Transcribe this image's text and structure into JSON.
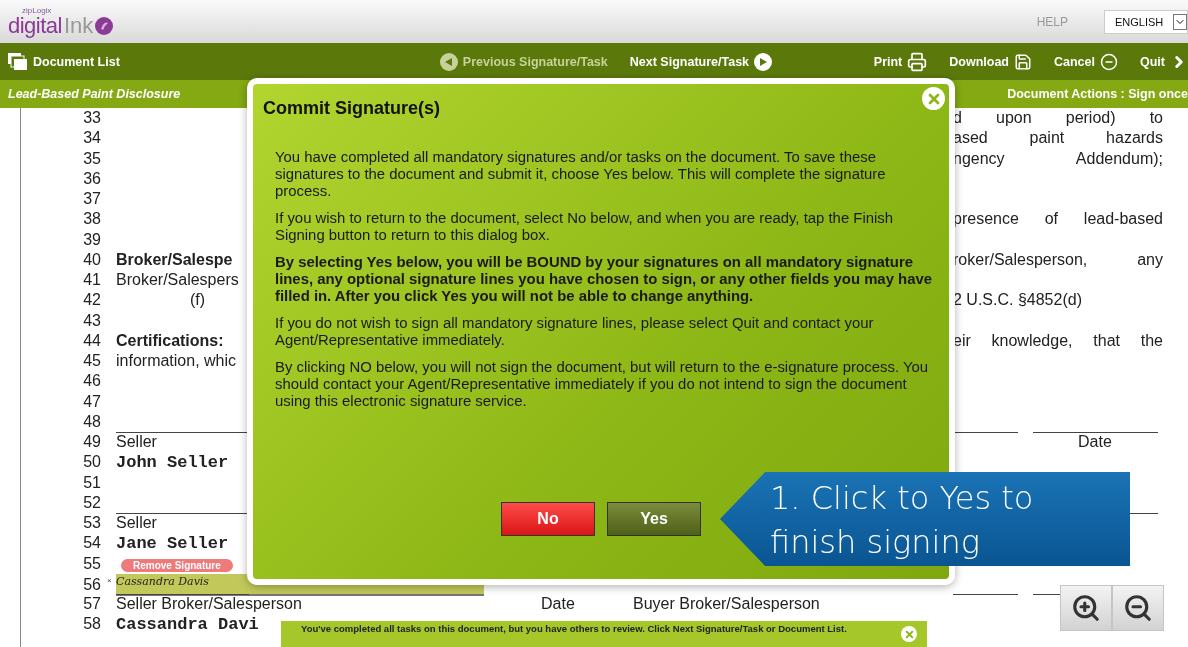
{
  "header": {
    "logo": {
      "tagline": "zipLogix",
      "name_primary": "digital",
      "name_secondary": "Ink"
    },
    "help": "HELP",
    "language": "ENGLISH"
  },
  "toolbar": {
    "left": [
      {
        "kind": "list",
        "label": "Document List",
        "disabled": false
      }
    ],
    "center": [
      {
        "kind": "prev",
        "label": "Previous Signature/Task",
        "disabled": true
      },
      {
        "kind": "next",
        "label": "Next Signature/Task",
        "disabled": false
      }
    ],
    "right": [
      {
        "kind": "print",
        "label": "Print",
        "disabled": false
      },
      {
        "kind": "download",
        "label": "Download",
        "disabled": false
      },
      {
        "kind": "cancel",
        "label": "Cancel",
        "disabled": false
      },
      {
        "kind": "quit",
        "label": "Quit",
        "disabled": false
      }
    ]
  },
  "subbar": {
    "document_title": "Lead-Based Paint Disclosure",
    "actions": "Document Actions : Sign once"
  },
  "document": {
    "lines": [
      {
        "number": "33",
        "right": {
          "kind": "text",
          "text": "d upon period) to"
        }
      },
      {
        "number": "34",
        "right": {
          "kind": "text",
          "text": "ased paint hazards"
        }
      },
      {
        "number": "35",
        "right": {
          "kind": "text",
          "text": "ngency Addendum);"
        }
      },
      {
        "number": "36"
      },
      {
        "number": "37"
      },
      {
        "number": "38",
        "right": {
          "kind": "text",
          "text": "presence of lead-based"
        }
      },
      {
        "number": "39"
      },
      {
        "number": "40",
        "left": [
          {
            "kind": "bold",
            "text": "Broker/Salespe"
          }
        ],
        "right": {
          "kind": "text",
          "text": "roker/Salesperson, any"
        }
      },
      {
        "number": "41",
        "left": [
          {
            "kind": "plain",
            "text": "Broker/Salespers"
          }
        ]
      },
      {
        "number": "42",
        "left": [
          {
            "kind": "indent",
            "text": "(f)"
          }
        ],
        "right": {
          "kind": "short",
          "text": "2 U.S.C. §4852(d)"
        }
      },
      {
        "number": "43"
      },
      {
        "number": "44",
        "left": [
          {
            "kind": "bold",
            "text": "Certifications:"
          }
        ],
        "right": {
          "kind": "text",
          "text": "eir knowledge, that the"
        }
      },
      {
        "number": "45",
        "left": [
          {
            "kind": "plain",
            "text": "information, whic"
          }
        ]
      },
      {
        "number": "46"
      },
      {
        "number": "47"
      },
      {
        "number": "48"
      },
      {
        "number": "49",
        "ruled": true,
        "left": [
          {
            "kind": "plain",
            "text": "Seller"
          }
        ],
        "right": {
          "kind": "caption",
          "text": "Date"
        }
      },
      {
        "number": "50",
        "left": [
          {
            "kind": "name",
            "text": "John Seller"
          }
        ]
      },
      {
        "number": "51"
      },
      {
        "number": "52"
      },
      {
        "number": "53",
        "ruled": true,
        "left": [
          {
            "kind": "plain",
            "text": "Seller"
          }
        ]
      },
      {
        "number": "54",
        "left": [
          {
            "kind": "name",
            "text": "Jane Seller"
          }
        ]
      },
      {
        "number": "55",
        "left": [
          {
            "kind": "remove",
            "text": "Remove Signature"
          }
        ]
      },
      {
        "number": "56",
        "left": [
          {
            "kind": "signature",
            "text": "Cassandra Davis",
            "mark": "×"
          }
        ]
      },
      {
        "number": "57",
        "ruled": true,
        "left": [
          {
            "kind": "plain",
            "text": "Seller Broker/Salesperson"
          },
          {
            "kind": "plain",
            "text": "Date"
          },
          {
            "kind": "plain",
            "text": "Buyer Broker/Salesperson"
          }
        ]
      },
      {
        "number": "58",
        "left": [
          {
            "kind": "name",
            "text": "Cassandra Davi"
          }
        ]
      }
    ]
  },
  "dialog": {
    "title": "Commit Signature(s)",
    "paragraphs": [
      {
        "kind": "plain",
        "text": "You have completed all mandatory signatures and/or tasks on the document. To save these signatures to the document and submit it, choose Yes below. This will complete the signature process."
      },
      {
        "kind": "plain",
        "text": "If you wish to return to the document, select No below, and when you are ready, tap the Finish Signing button to return to this dialog box."
      },
      {
        "kind": "bold",
        "text": "By selecting Yes below, you will be BOUND by your signatures on all mandatory signature lines, any optional signature lines you have chosen to sign, or any other fields you may have filled in. After you click Yes you will not be able to change anything."
      },
      {
        "kind": "plain",
        "text": "If you do not wish to sign all mandatory signature lines, please select Quit and contact your Agent/Representative immediately."
      },
      {
        "kind": "plain",
        "text": "By clicking NO below, you will not sign the document, but will return to the e-signature process. You should contact your Agent/Representative immediately if you do not intend to sign the document using this electronic signature service."
      }
    ],
    "buttons": [
      {
        "kind": "no",
        "label": "No"
      },
      {
        "kind": "yes",
        "label": "Yes"
      }
    ]
  },
  "callout": "1. Click to Yes to finish signing",
  "notification": "You've completed all tasks on this document, but you have others to review. Click Next Signature/Task or Document List."
}
